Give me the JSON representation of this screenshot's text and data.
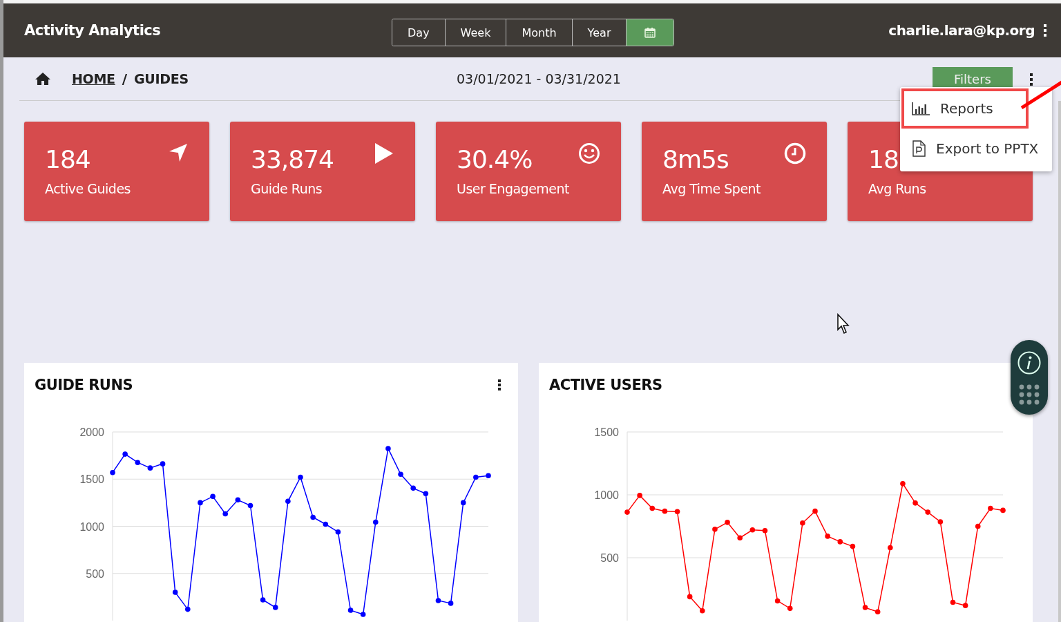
{
  "header": {
    "title": "Activity Analytics",
    "periods": [
      {
        "kind": "text",
        "label": "Day",
        "selected": false
      },
      {
        "kind": "text",
        "label": "Week",
        "selected": false
      },
      {
        "kind": "text",
        "label": "Month",
        "selected": false
      },
      {
        "kind": "text",
        "label": "Year",
        "selected": false
      },
      {
        "kind": "calendar",
        "selected": true
      }
    ],
    "user": "charlie.lara@kp.org"
  },
  "breadcrumb": {
    "items": [
      {
        "kind": "link",
        "label": "HOME"
      },
      {
        "kind": "current",
        "label": "GUIDES"
      }
    ],
    "separator": "/"
  },
  "date_range": "03/01/2021 - 03/31/2021",
  "filters_button": "Filters",
  "stats": [
    {
      "kind": "navigation",
      "value": "184",
      "label": "Active Guides"
    },
    {
      "kind": "play",
      "value": "33,874",
      "label": "Guide Runs"
    },
    {
      "kind": "smile",
      "value": "30.4%",
      "label": "User Engagement"
    },
    {
      "kind": "clock",
      "value": "8m5s",
      "label": "Avg Time Spent"
    },
    {
      "value": "18",
      "label": "Avg Runs"
    }
  ],
  "menu": {
    "items": [
      {
        "kind": "chart",
        "label": "Reports",
        "highlighted": true
      },
      {
        "kind": "pptx",
        "label": "Export to PPTX",
        "highlighted": false
      }
    ]
  },
  "charts": [
    {
      "title": "GUIDE RUNS",
      "menu": true,
      "chart_data": {
        "type": "line",
        "grid": true,
        "ylim": [
          0,
          2000
        ],
        "yticks": [
          500,
          1000,
          1500,
          2000
        ],
        "series": [
          {
            "color": "#0000ff",
            "marker": true,
            "values": [
              1570,
              1765,
              1676,
              1618,
              1662,
              300,
              120,
              1250,
              1316,
              1132,
              1280,
              1220,
              220,
              140,
              1265,
              1520,
              1095,
              1022,
              940,
              110,
              66,
              1044,
              1824,
              1551,
              1404,
              1346,
              213,
              184,
              1250,
              1520,
              1537
            ]
          }
        ]
      }
    },
    {
      "title": "ACTIVE USERS",
      "chart_data": {
        "type": "line",
        "grid": true,
        "ylim": [
          0,
          1500
        ],
        "yticks": [
          500,
          1000,
          1500
        ],
        "series": [
          {
            "color": "#ff0000",
            "marker": true,
            "values": [
              862,
              995,
              893,
              870,
              867,
              190,
              78,
              726,
              781,
              658,
              721,
              716,
              157,
              97,
              776,
              870,
              671,
              627,
              590,
              104,
              70,
              580,
              1089,
              935,
              862,
              786,
              146,
              120,
              750,
              893,
              877
            ]
          }
        ]
      }
    }
  ]
}
